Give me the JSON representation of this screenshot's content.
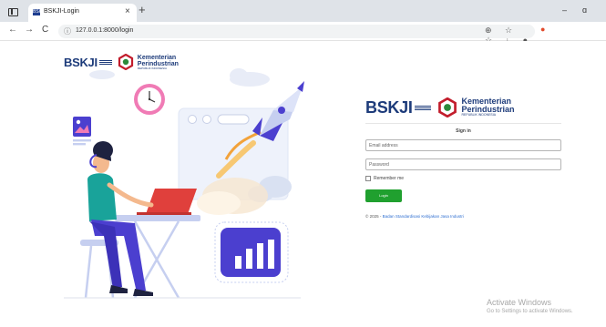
{
  "browser": {
    "tab_title": "BSKJI-Login",
    "favicon_text": "BSK",
    "tab_close": "×",
    "new_tab": "+",
    "url": "127.0.0.1:8000/login",
    "window_controls": {
      "minimize": "–",
      "restore": "ɑ"
    }
  },
  "nav": {
    "back": "←",
    "forward": "→",
    "reload": "C",
    "info": "ⓘ"
  },
  "toolbar": {
    "tools": "⊕ ☆ ☆ ↓ ● ···"
  },
  "brand": {
    "bskji": "BSKJI",
    "kemen_line1": "Kementerian",
    "kemen_line2": "Perindustrian",
    "kemen_sub": "REPUBLIK INDONESIA"
  },
  "login": {
    "heading": "Sign in",
    "email_placeholder": "Email address",
    "password_placeholder": "Password",
    "remember_label": "Remember me",
    "login_button": "Login",
    "footer_prefix": "© 2025 - ",
    "footer_link": "Badan Standardisasi Kebijakan Jasa Industri"
  },
  "watermark": {
    "line1": "Activate Windows",
    "line2": "Go to Settings to activate Windows."
  },
  "colors": {
    "brand_navy": "#1d3b7a",
    "brand_red": "#c21d2c",
    "login_green": "#20a02f",
    "illustration_purple": "#4b3fcf",
    "illustration_orange": "#f2a23a",
    "clock_pink": "#f07bb5"
  }
}
